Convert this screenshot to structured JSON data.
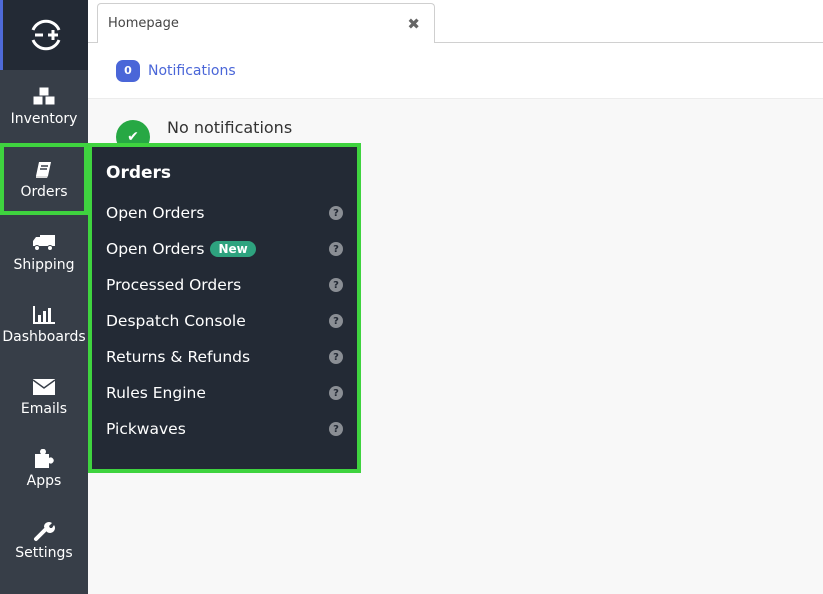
{
  "sidebar": {
    "logo_icon": "linnworks-logo-icon",
    "items": [
      {
        "label": "Inventory",
        "icon": "cubes-icon"
      },
      {
        "label": "Orders",
        "icon": "book-icon",
        "active": true
      },
      {
        "label": "Shipping",
        "icon": "truck-icon"
      },
      {
        "label": "Dashboards",
        "icon": "bar-chart-icon"
      },
      {
        "label": "Emails",
        "icon": "envelope-icon"
      },
      {
        "label": "Apps",
        "icon": "puzzle-icon"
      },
      {
        "label": "Settings",
        "icon": "wrench-icon"
      }
    ]
  },
  "tabs": [
    {
      "label": "Homepage",
      "close_icon": "close-icon"
    }
  ],
  "notifications": {
    "count": "0",
    "label": "Notifications",
    "empty_text": "No notifications"
  },
  "flyout": {
    "title": "Orders",
    "items": [
      {
        "label": "Open Orders"
      },
      {
        "label": "Open Orders",
        "badge": "New"
      },
      {
        "label": "Processed Orders"
      },
      {
        "label": "Despatch Console"
      },
      {
        "label": "Returns & Refunds"
      },
      {
        "label": "Rules Engine"
      },
      {
        "label": "Pickwaves"
      }
    ],
    "help_glyph": "?"
  },
  "colors": {
    "sidebar": "#373e48",
    "flyout": "#232a35",
    "highlight": "#3fd33f",
    "accent": "#4a66d8",
    "success": "#27a844",
    "new_badge": "#2ea37f"
  }
}
